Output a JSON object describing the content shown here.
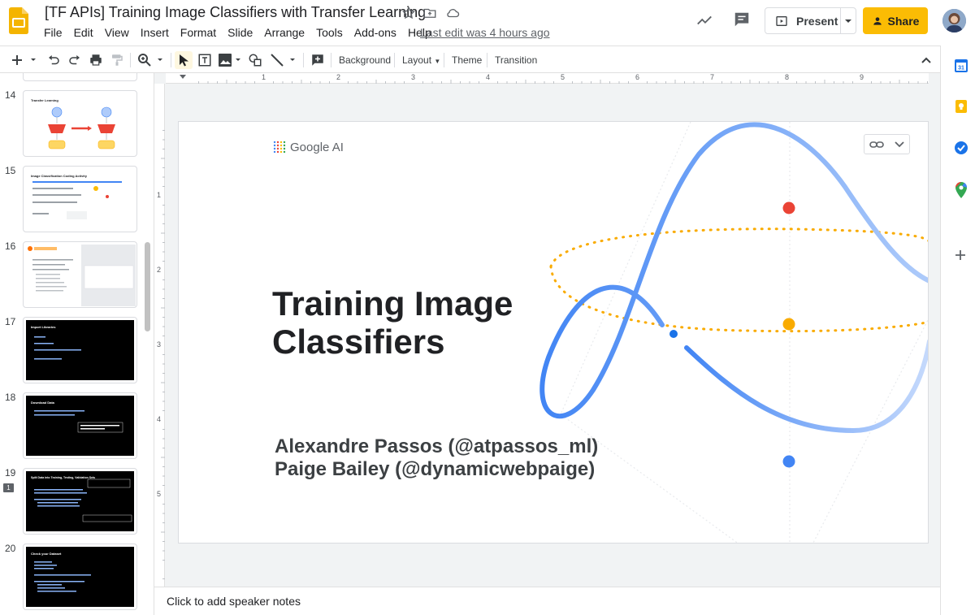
{
  "app": {
    "doc_title": "[TF APIs] Training Image Classifiers with Transfer Learning",
    "menu": [
      "File",
      "Edit",
      "View",
      "Insert",
      "Format",
      "Slide",
      "Arrange",
      "Tools",
      "Add-ons",
      "Help"
    ],
    "last_edit": "Last edit was 4 hours ago",
    "present_label": "Present",
    "share_label": "Share"
  },
  "toolbar": {
    "background_label": "Background",
    "layout_label": "Layout",
    "theme_label": "Theme",
    "transition_label": "Transition"
  },
  "ruler": {
    "h_ticks": [
      "1",
      "2",
      "3",
      "4",
      "5",
      "6",
      "7",
      "8",
      "9"
    ],
    "v_ticks": [
      "1",
      "2",
      "3",
      "4",
      "5"
    ]
  },
  "filmstrip": {
    "slides": [
      {
        "num": "14",
        "title": "Transfer Learning",
        "dark": false
      },
      {
        "num": "15",
        "title": "Image Classification Coding Activity",
        "dark": false
      },
      {
        "num": "16",
        "title": "TensorFlow Hub",
        "dark": false
      },
      {
        "num": "17",
        "title": "Import Libraries",
        "dark": true
      },
      {
        "num": "18",
        "title": "Download Data",
        "dark": true
      },
      {
        "num": "19",
        "title": "Split Data into Training, Testing, Validation Sets",
        "dark": true
      },
      {
        "num": "20",
        "title": "Check your Dataset",
        "dark": true
      }
    ]
  },
  "slide": {
    "brand": "Google AI",
    "title_line1": "Training Image",
    "title_line2": "Classifiers",
    "author1": "Alexandre Passos (@atpassos_ml)",
    "author2": "Paige Bailey (@dynamicwebpaige)"
  },
  "notes": {
    "placeholder": "Click to add speaker notes"
  },
  "colors": {
    "accent_yellow": "#fbbc04",
    "google_blue": "#4285f4",
    "google_red": "#ea4335",
    "dots_orange": "#f9ab00"
  }
}
